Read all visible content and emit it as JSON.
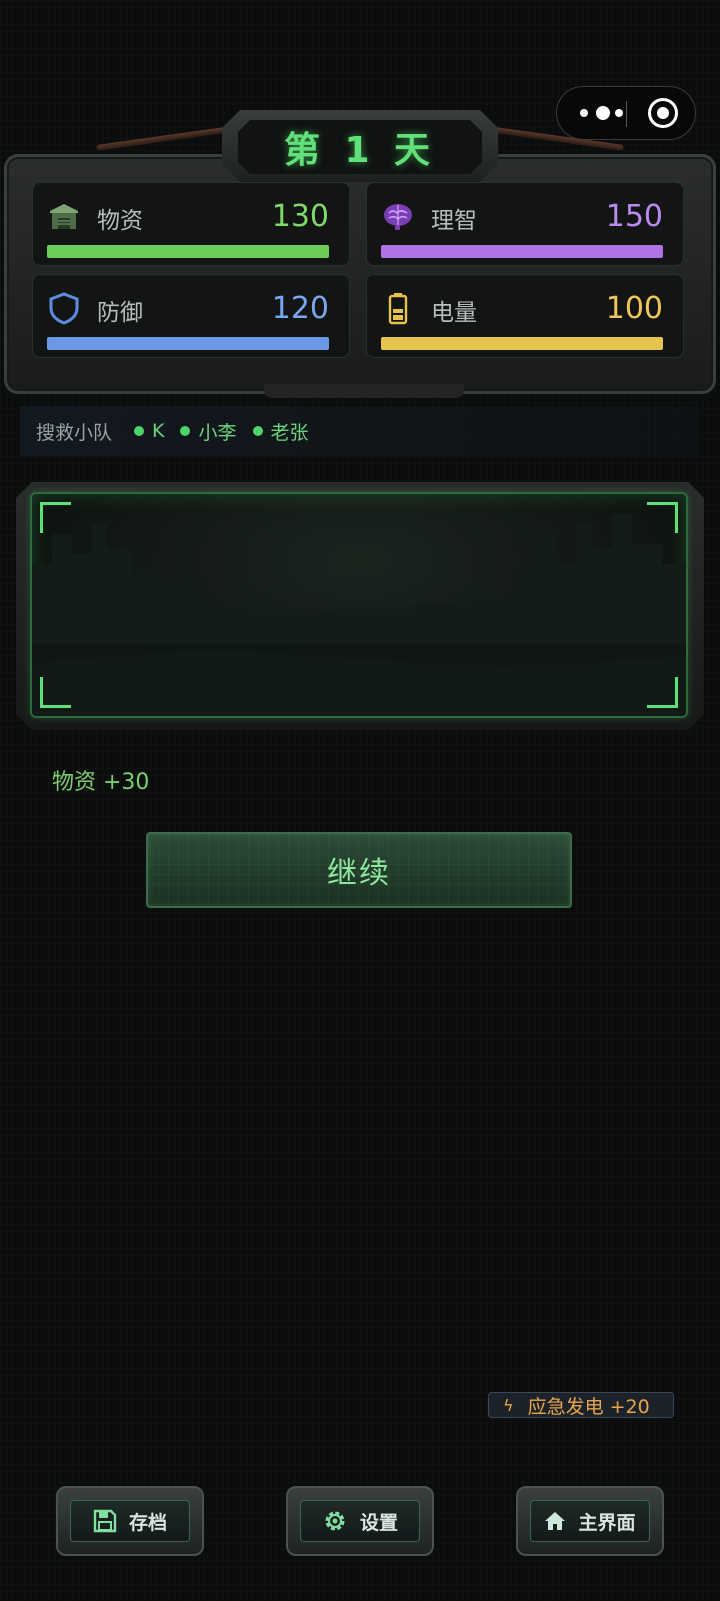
{
  "day_title": "第 1 天",
  "stats": [
    {
      "key": "supplies",
      "label": "物资",
      "value": 130,
      "value_text": "130",
      "color": "#6ccc57",
      "value_color": "#7fd86a",
      "fill": 1.0,
      "icon": "warehouse-icon"
    },
    {
      "key": "sanity",
      "label": "理智",
      "value": 150,
      "value_text": "150",
      "color": "#b172e6",
      "value_color": "#b98aef",
      "fill": 1.0,
      "icon": "brain-icon"
    },
    {
      "key": "defense",
      "label": "防御",
      "value": 120,
      "value_text": "120",
      "color": "#6c97e4",
      "value_color": "#7aa6ee",
      "fill": 1.0,
      "icon": "shield-icon"
    },
    {
      "key": "power",
      "label": "电量",
      "value": 100,
      "value_text": "100",
      "color": "#e6c24e",
      "value_color": "#f0c55a",
      "fill": 1.0,
      "icon": "battery-icon"
    }
  ],
  "team": {
    "title": "搜救小队",
    "members": [
      "K",
      "小李",
      "老张"
    ]
  },
  "result_text": "物资 +30",
  "continue_label": "继续",
  "emergency": {
    "label": "应急发电 +20",
    "icon": "lightning-icon"
  },
  "bottom_buttons": [
    {
      "label": "存档",
      "icon": "save-icon"
    },
    {
      "label": "设置",
      "icon": "gear-icon"
    },
    {
      "label": "主界面",
      "icon": "home-icon"
    }
  ]
}
